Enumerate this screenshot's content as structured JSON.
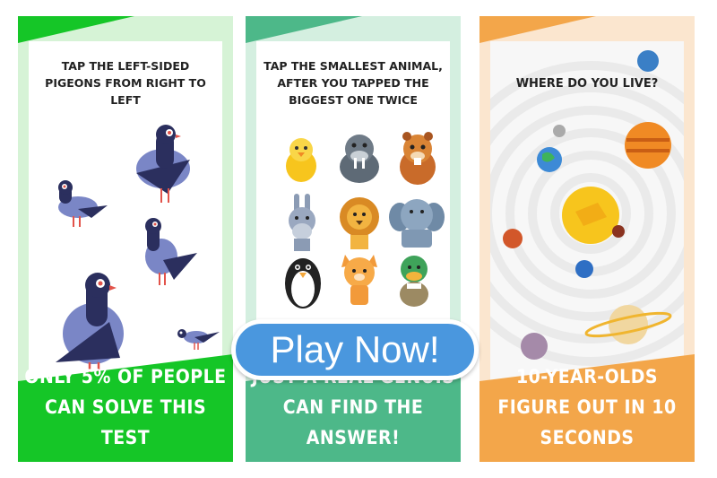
{
  "panels": [
    {
      "title": "TAP THE LEFT-SIDED PIGEONS FROM RIGHT TO LEFT",
      "caption": "ONLY 5% OF PEOPLE CAN SOLVE THIS TEST",
      "accent": "#15c627"
    },
    {
      "title": "TAP THE SMALLEST ANIMAL, AFTER YOU TAPPED THE BIGGEST ONE TWICE",
      "caption": "JUST A REAL GENUIS CAN FIND THE ANSWER!",
      "accent": "#4db889"
    },
    {
      "title": "WHERE DO YOU LIVE?",
      "caption": "10-YEAR-OLDS FIGURE OUT IN 10 SECONDS",
      "accent": "#f3a64a"
    }
  ],
  "play_button": {
    "label": "Play Now!",
    "color": "#4a97de"
  }
}
